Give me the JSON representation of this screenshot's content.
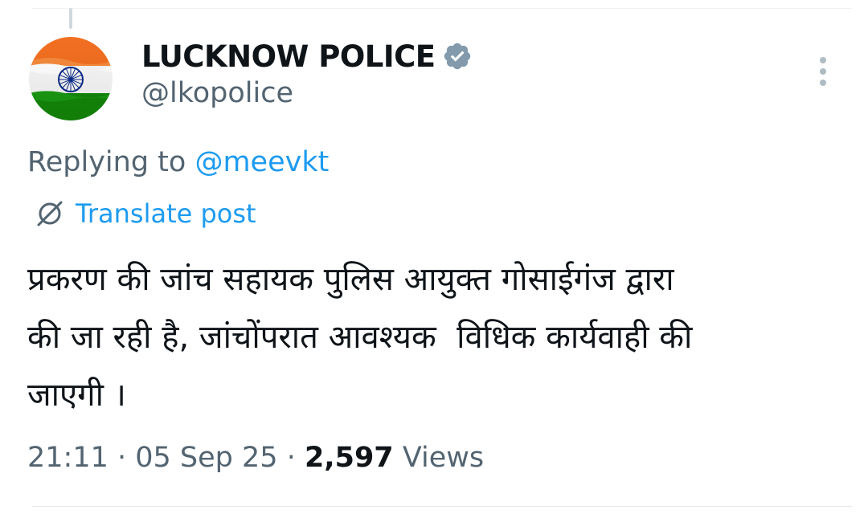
{
  "author": {
    "display_name": "LUCKNOW POLICE",
    "handle": "@lkopolice",
    "verified": true,
    "verified_badge_color": "#829aab",
    "avatar": "india-flag-avatar"
  },
  "reply": {
    "prefix": "Replying to ",
    "mention": "@meevkt"
  },
  "translate": {
    "icon": "globe-slash-icon",
    "label": "Translate post"
  },
  "post": {
    "text": "प्रकरण की जांच सहायक पुलिस आयुक्त गोसाईगंज द्वारा\nकी जा रही है, जांचोंपरात आवश्यक  विधिक कार्यवाही की\nजाएगी ।"
  },
  "meta": {
    "time": "21:11",
    "separator": " · ",
    "date": "05 Sep 25",
    "views_count": "2,597",
    "views_label": "Views"
  },
  "colors": {
    "link": "#1d9bf0",
    "secondary_text": "#536471",
    "primary_text": "#0f1419"
  }
}
